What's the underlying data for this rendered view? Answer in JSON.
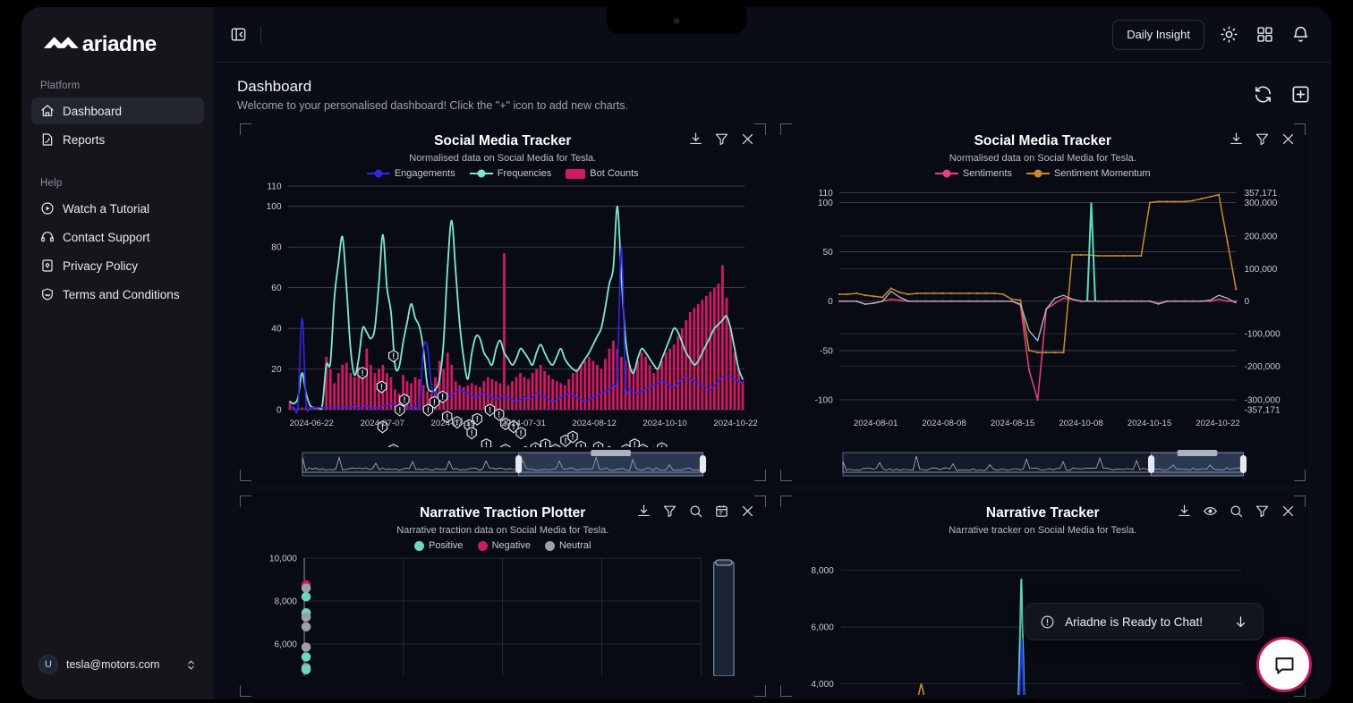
{
  "app": {
    "brand": "ariadne"
  },
  "sidebar": {
    "groups": [
      {
        "label": "Platform",
        "items": [
          {
            "label": "Dashboard",
            "icon": "home-icon",
            "active": true
          },
          {
            "label": "Reports",
            "icon": "report-icon",
            "active": false
          }
        ]
      },
      {
        "label": "Help",
        "items": [
          {
            "label": "Watch a Tutorial",
            "icon": "play-circle-icon",
            "active": false
          },
          {
            "label": "Contact Support",
            "icon": "headset-icon",
            "active": false
          },
          {
            "label": "Privacy Policy",
            "icon": "lock-doc-icon",
            "active": false
          },
          {
            "label": "Terms and Conditions",
            "icon": "shield-handshake-icon",
            "active": false
          }
        ]
      }
    ],
    "user": {
      "initial": "U",
      "email": "tesla@motors.com"
    }
  },
  "topbar": {
    "collapse_icon": "panel-collapse-icon",
    "daily_insight_label": "Daily Insight",
    "theme_icon": "sun-icon",
    "apps_icon": "grid-apps-icon",
    "bell_icon": "bell-icon"
  },
  "page": {
    "title": "Dashboard",
    "subtitle": "Welcome to your personalised dashboard! Click the \"+\" icon to add new charts.",
    "refresh_icon": "refresh-icon",
    "add_icon": "plus-square-icon"
  },
  "chat": {
    "toast_text": "Ariadne is Ready to Chat!",
    "info_icon": "info-circle-icon",
    "dismiss_icon": "arrow-down-icon",
    "fab_icon": "chat-bubble-icon",
    "fab_border_color": "#c2185b"
  },
  "colors": {
    "engagements": "#3524e8",
    "frequencies": "#7fe7cf",
    "bot_counts": "#cf1a63",
    "sentiments": "#e8407f",
    "sentiment_momentum": "#c58a2e",
    "positive": "#6ed7bd",
    "negative": "#d01a63",
    "neutral": "#9ba0aa",
    "panel_bg": "#080b14",
    "sidebar_bg": "#14161c",
    "app_bg": "#0a0d17"
  },
  "panels": [
    {
      "id": "social-media-tracker-1",
      "title": "Social Media Tracker",
      "subtitle": "Normalised data on Social Media for Tesla.",
      "tools": [
        "download-icon",
        "filter-icon",
        "close-icon"
      ]
    },
    {
      "id": "social-media-tracker-2",
      "title": "Social Media Tracker",
      "subtitle": "Normalised data on Social Media for Tesla.",
      "tools": [
        "download-icon",
        "filter-icon",
        "close-icon"
      ]
    },
    {
      "id": "narrative-traction-plotter",
      "title": "Narrative Traction Plotter",
      "subtitle": "Narrative traction data on Social Media for Tesla.",
      "tools": [
        "download-icon",
        "filter-icon",
        "search-icon",
        "calendar-icon",
        "close-icon"
      ]
    },
    {
      "id": "narrative-tracker",
      "title": "Narrative Tracker",
      "subtitle": "Narrative tracker on Social Media for Tesla.",
      "tools": [
        "download-icon",
        "eye-icon",
        "search-icon",
        "filter-icon",
        "close-icon"
      ]
    }
  ],
  "chart_data": [
    {
      "id": "social-media-tracker-1",
      "type": "line",
      "title": "Social Media Tracker",
      "subtitle": "Normalised data on Social Media for Tesla.",
      "xlabel": "",
      "ylabel": "",
      "ylim": [
        0,
        110
      ],
      "yticks": [
        0,
        20,
        40,
        60,
        80,
        100,
        110
      ],
      "grid": true,
      "legend_position": "top",
      "xticks": [
        "2024-06-22",
        "2024-07-07",
        "2024-07-19",
        "2024-07-31",
        "2024-08-12",
        "2024-10-10",
        "2024-10-22"
      ],
      "legend": [
        "Engagements",
        "Frequencies",
        "Bot Counts"
      ],
      "series": [
        {
          "name": "Engagements",
          "color": "#3524e8",
          "kind": "line",
          "values": [
            2,
            1,
            2,
            45,
            3,
            1,
            1,
            1,
            1,
            1,
            1,
            1,
            1,
            1,
            1,
            1,
            2,
            1,
            1,
            2,
            1,
            1,
            1,
            2,
            2,
            3,
            2,
            2,
            2,
            1,
            1,
            2,
            2,
            30,
            31,
            12,
            8,
            6,
            5,
            6,
            7,
            9,
            10,
            9,
            8,
            7,
            6,
            7,
            8,
            7,
            6,
            5,
            6,
            7,
            6,
            5,
            4,
            5,
            6,
            5,
            6,
            8,
            7,
            6,
            5,
            4,
            5,
            6,
            7,
            8,
            7,
            6,
            5,
            4,
            5,
            6,
            7,
            8,
            9,
            10,
            12,
            18,
            80,
            14,
            10,
            9,
            8,
            9,
            10,
            11,
            12,
            13,
            14,
            13,
            12,
            11,
            13,
            15,
            16,
            15,
            14,
            13,
            12,
            11,
            10,
            12,
            14,
            16,
            17,
            16,
            15,
            14,
            13
          ]
        },
        {
          "name": "Frequencies",
          "color": "#7fe7cf",
          "kind": "line",
          "values": [
            4,
            3,
            6,
            18,
            8,
            2,
            1,
            1,
            2,
            22,
            23,
            55,
            72,
            85,
            60,
            30,
            17,
            25,
            40,
            38,
            35,
            40,
            62,
            86,
            60,
            48,
            22,
            21,
            33,
            43,
            52,
            45,
            41,
            30,
            12,
            9,
            10,
            15,
            33,
            70,
            93,
            68,
            42,
            25,
            15,
            28,
            36,
            35,
            28,
            25,
            22,
            30,
            34,
            28,
            25,
            22,
            25,
            30,
            28,
            25,
            22,
            28,
            32,
            28,
            24,
            22,
            26,
            30,
            25,
            22,
            20,
            19,
            22,
            25,
            28,
            32,
            36,
            40,
            50,
            62,
            70,
            100,
            65,
            35,
            22,
            18,
            25,
            30,
            28,
            25,
            22,
            20,
            25,
            30,
            35,
            40,
            38,
            33,
            28,
            25,
            22,
            24,
            28,
            32,
            36,
            40,
            42,
            44,
            46,
            40,
            30,
            20,
            15
          ]
        },
        {
          "name": "Bot Counts",
          "color": "#cf1a63",
          "kind": "bar",
          "values": [
            4,
            1,
            1,
            1,
            1,
            1,
            1,
            1,
            1,
            26,
            20,
            13,
            18,
            22,
            23,
            18,
            16,
            21,
            19,
            30,
            22,
            18,
            20,
            22,
            18,
            16,
            10,
            8,
            17,
            14,
            13,
            16,
            15,
            12,
            9,
            8,
            16,
            24,
            20,
            28,
            22,
            14,
            12,
            11,
            12,
            13,
            12,
            11,
            14,
            16,
            15,
            14,
            13,
            77,
            12,
            14,
            16,
            18,
            16,
            15,
            18,
            20,
            22,
            19,
            17,
            15,
            14,
            13,
            12,
            15,
            18,
            20,
            22,
            24,
            26,
            24,
            22,
            20,
            25,
            30,
            34,
            30,
            26,
            24,
            22,
            20,
            24,
            28,
            26,
            22,
            18,
            20,
            24,
            28,
            30,
            32,
            36,
            40,
            44,
            48,
            50,
            52,
            54,
            56,
            58,
            60,
            62,
            71,
            55,
            40,
            28,
            20,
            14
          ]
        }
      ],
      "range_slider": {
        "visible": true,
        "selected_start_pct": 54,
        "selected_end_pct": 100
      }
    },
    {
      "id": "social-media-tracker-2",
      "type": "line",
      "title": "Social Media Tracker",
      "subtitle": "Normalised data on Social Media for Tesla.",
      "ylim": [
        -100,
        110
      ],
      "yticks_left": [
        -100,
        -50,
        0,
        50,
        100,
        110
      ],
      "yticks_right": [
        "-357,171",
        "-300,000",
        "-200,000",
        "-100,000",
        "0",
        "100,000",
        "200,000",
        "300,000",
        "357,171"
      ],
      "grid": true,
      "legend_position": "top",
      "legend": [
        "Sentiments",
        "Sentiment Momentum"
      ],
      "xticks": [
        "2024-08-01",
        "2024-08-08",
        "2024-08-15",
        "2024-10-08",
        "2024-10-15",
        "2024-10-22"
      ],
      "series": [
        {
          "name": "Sentiments",
          "color": "#e8407f",
          "kind": "line",
          "values": [
            0,
            0,
            0,
            -3,
            -2,
            0,
            2,
            1,
            0,
            0,
            0,
            0,
            0,
            0,
            0,
            0,
            0,
            0,
            0,
            0,
            0,
            -4,
            -70,
            -100,
            -8,
            -2,
            3,
            2,
            0,
            0,
            0,
            0,
            0,
            0,
            0,
            0,
            0,
            -2,
            0,
            0,
            0,
            0,
            0,
            0,
            2,
            0,
            0
          ]
        },
        {
          "name": "Sentiment Momentum",
          "color": "#c58a2e",
          "kind": "line",
          "values": [
            7,
            7,
            8,
            6,
            5,
            4,
            13,
            9,
            7,
            8,
            8,
            8,
            8,
            8,
            8,
            8,
            8,
            8,
            8,
            7,
            2,
            1,
            -50,
            -52,
            -52,
            -52,
            -52,
            47,
            47,
            47,
            46,
            46,
            46,
            46,
            46,
            46,
            100,
            101,
            101,
            101,
            101,
            102,
            104,
            106,
            108,
            60,
            12
          ]
        }
      ],
      "range_slider": {
        "visible": true,
        "selected_start_pct": 77,
        "selected_end_pct": 100
      }
    },
    {
      "id": "narrative-traction-plotter",
      "type": "scatter",
      "title": "Narrative Traction Plotter",
      "subtitle": "Narrative traction data on Social Media for Tesla.",
      "legend": [
        "Positive",
        "Negative",
        "Neutral"
      ],
      "legend_position": "top",
      "yticks": [
        "10,000",
        "8,000",
        "6,000"
      ],
      "ylim": [
        4500,
        10000
      ],
      "grid": true,
      "points": [
        {
          "y": 8750,
          "series": "Negative"
        },
        {
          "y": 8600,
          "series": "Neutral"
        },
        {
          "y": 8200,
          "series": "Positive"
        },
        {
          "y": 7450,
          "series": "Positive"
        },
        {
          "y": 7250,
          "series": "Neutral"
        },
        {
          "y": 6800,
          "series": "Neutral"
        },
        {
          "y": 5850,
          "series": "Neutral"
        },
        {
          "y": 5400,
          "series": "Positive"
        },
        {
          "y": 4900,
          "series": "Neutral"
        },
        {
          "y": 4800,
          "series": "Positive"
        }
      ]
    },
    {
      "id": "narrative-tracker",
      "type": "line",
      "title": "Narrative Tracker",
      "subtitle": "Narrative tracker on Social Media for Tesla.",
      "yticks": [
        "8,000",
        "6,000",
        "4,000"
      ],
      "ylim": [
        3600,
        8400
      ],
      "grid": true,
      "series": [
        {
          "name": "spike-teal",
          "color": "#5fd9bd",
          "peak": 7700
        },
        {
          "name": "spike-blue",
          "color": "#2b2fe0",
          "peak": 5600
        },
        {
          "name": "marker-amber",
          "color": "#c58a2e",
          "peak": 4000
        }
      ]
    }
  ]
}
